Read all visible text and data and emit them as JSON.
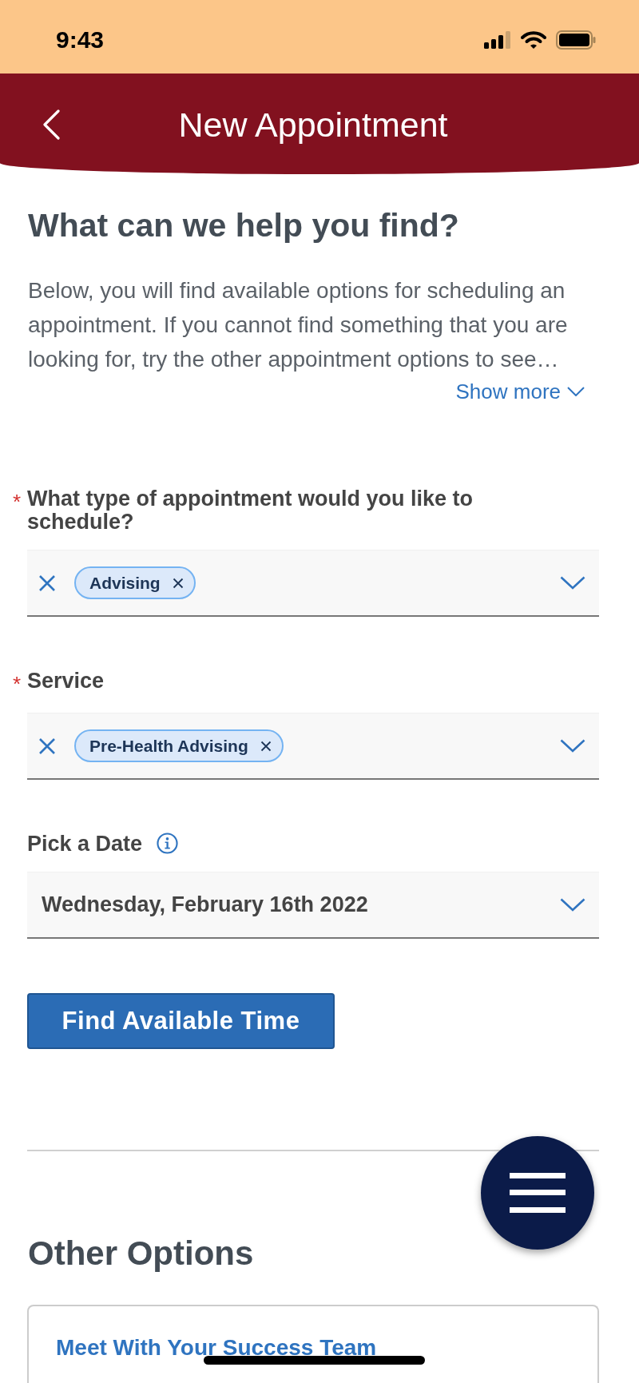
{
  "status_bar": {
    "time": "9:43"
  },
  "header": {
    "title": "New Appointment"
  },
  "intro": {
    "heading": "What can we help you find?",
    "text": "Below, you will find available options for scheduling an appointment. If you cannot find something that you are looking for, try the other appointment options to see…",
    "toggle": "Show more"
  },
  "fields": [
    {
      "kind": "multiselect",
      "required_mark": "*",
      "label": "What type of appointment would you like to schedule?",
      "chips": [
        "Advising"
      ]
    },
    {
      "kind": "multiselect",
      "required_mark": "*",
      "label": "Service",
      "chips": [
        "Pre-Health Advising"
      ]
    },
    {
      "kind": "select",
      "label": "Pick a Date",
      "info": true,
      "value": "Wednesday, February 16th 2022"
    }
  ],
  "primary_button": "Find Available Time",
  "other_options": {
    "heading": "Other Options",
    "cards": [
      {
        "title": "Meet With Your Success Team"
      }
    ]
  }
}
